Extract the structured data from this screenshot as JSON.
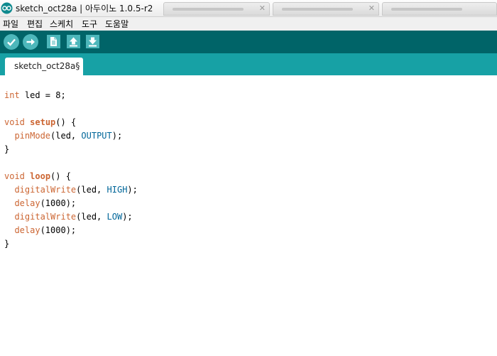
{
  "window": {
    "title": "sketch_oct28a | 아두이노 1.0.5-r2"
  },
  "menu": {
    "items": [
      "파일",
      "편집",
      "스케치",
      "도구",
      "도움말"
    ]
  },
  "toolbar": {
    "buttons": [
      "verify-icon",
      "upload-icon",
      "new-icon",
      "open-icon",
      "save-icon"
    ]
  },
  "tabs": [
    {
      "label": "sketch_oct28a§"
    }
  ],
  "editor": {
    "lines": [
      [
        {
          "t": "int",
          "c": "type"
        },
        {
          "t": " led = 8;",
          "c": "plain"
        }
      ],
      [],
      [
        {
          "t": "void",
          "c": "type"
        },
        {
          "t": " ",
          "c": "plain"
        },
        {
          "t": "setup",
          "c": "fn"
        },
        {
          "t": "() {",
          "c": "plain"
        }
      ],
      [
        {
          "t": "  ",
          "c": "plain"
        },
        {
          "t": "pinMode",
          "c": "builtin"
        },
        {
          "t": "(led, ",
          "c": "plain"
        },
        {
          "t": "OUTPUT",
          "c": "const"
        },
        {
          "t": ");",
          "c": "plain"
        }
      ],
      [
        {
          "t": "}",
          "c": "plain"
        }
      ],
      [],
      [
        {
          "t": "void",
          "c": "type"
        },
        {
          "t": " ",
          "c": "plain"
        },
        {
          "t": "loop",
          "c": "fn"
        },
        {
          "t": "() {",
          "c": "plain"
        }
      ],
      [
        {
          "t": "  ",
          "c": "plain"
        },
        {
          "t": "digitalWrite",
          "c": "builtin"
        },
        {
          "t": "(led, ",
          "c": "plain"
        },
        {
          "t": "HIGH",
          "c": "const"
        },
        {
          "t": ");",
          "c": "plain"
        }
      ],
      [
        {
          "t": "  ",
          "c": "plain"
        },
        {
          "t": "delay",
          "c": "builtin"
        },
        {
          "t": "(1000);",
          "c": "plain"
        }
      ],
      [
        {
          "t": "  ",
          "c": "plain"
        },
        {
          "t": "digitalWrite",
          "c": "builtin"
        },
        {
          "t": "(led, ",
          "c": "plain"
        },
        {
          "t": "LOW",
          "c": "const"
        },
        {
          "t": ");",
          "c": "plain"
        }
      ],
      [
        {
          "t": "  ",
          "c": "plain"
        },
        {
          "t": "delay",
          "c": "builtin"
        },
        {
          "t": "(1000);",
          "c": "plain"
        }
      ],
      [
        {
          "t": "}",
          "c": "plain"
        }
      ]
    ]
  },
  "colors": {
    "toolbar_bg": "#006468",
    "tabstrip_bg": "#17a1a5",
    "button_bg": "#4db7bb",
    "keyword": "#cc6633",
    "constant": "#006699"
  }
}
